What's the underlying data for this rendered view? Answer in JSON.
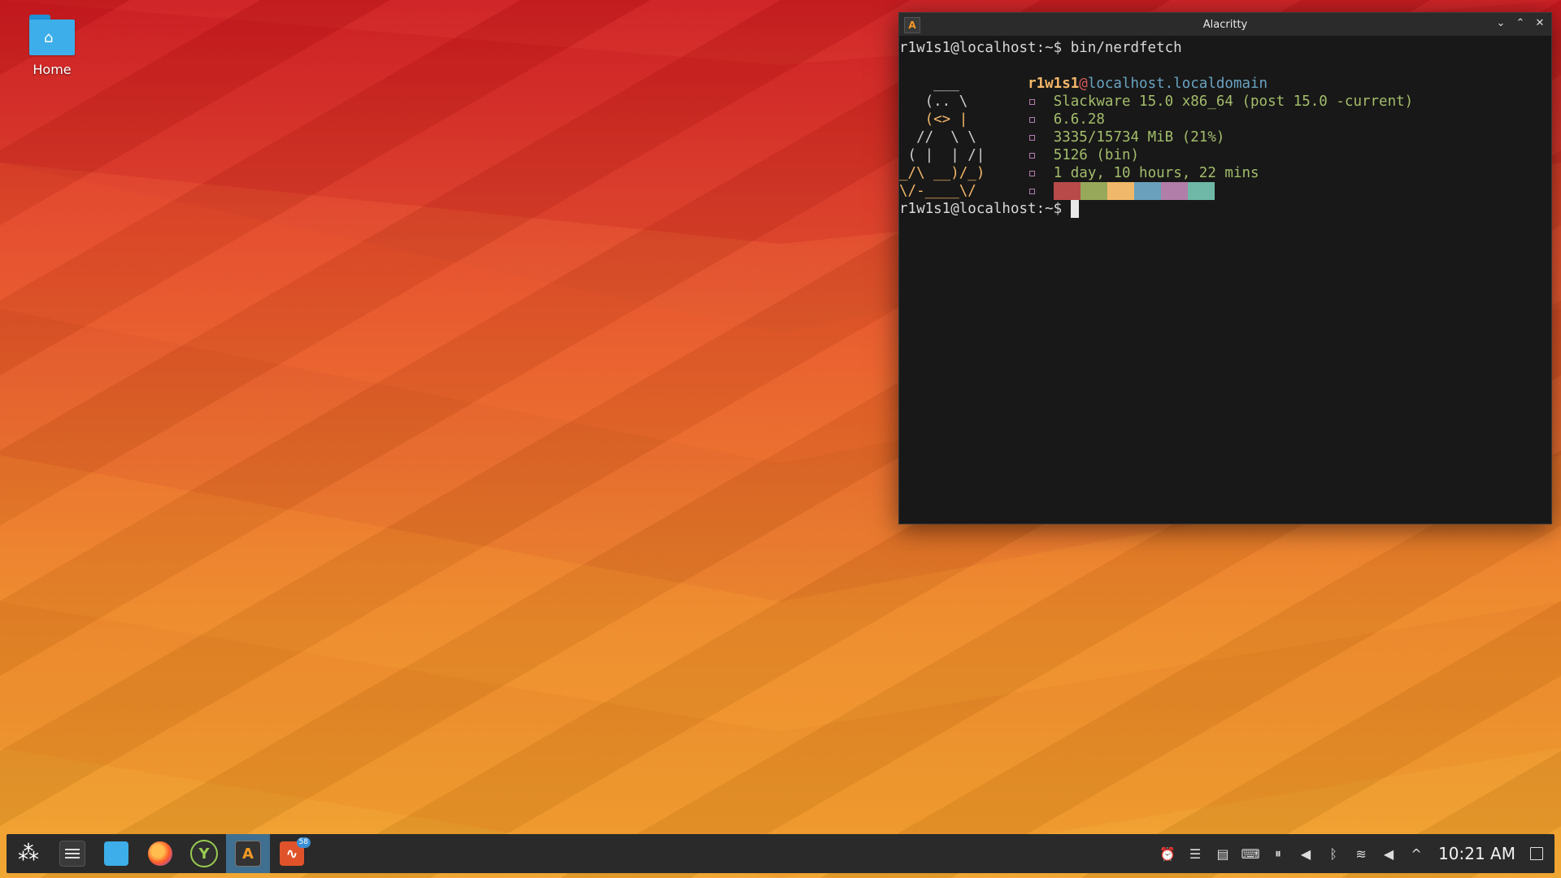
{
  "desktop": {
    "home_label": "Home"
  },
  "window": {
    "title": "Alacritty",
    "controls": {
      "minimize": "⌄",
      "maximize": "⌃",
      "close": "✕"
    },
    "app_icon_glyph": "A"
  },
  "terminal": {
    "prompt1": "r1w1s1@localhost:~$",
    "command1": " bin/nerdfetch",
    "ascii": [
      "    ___    ",
      "   (.. \\   ",
      "   (<> |   ",
      "  //  \\ \\  ",
      " ( |  | /| ",
      "_/\\ __)/_) ",
      "\\/-____\\/  "
    ],
    "user": "r1w1s1",
    "at": "@",
    "host": "localhost.localdomain",
    "bullet": "▫",
    "info": [
      "Slackware 15.0 x86_64 (post 15.0 -current)",
      "6.6.28",
      "3335/15734 MiB (21%)",
      "5126 (bin)",
      "1 day, 10 hours, 22 mins"
    ],
    "palette": [
      "#b84a4a",
      "#98a85a",
      "#f0b86a",
      "#6aa0bb",
      "#b07ea8",
      "#6fb8a8"
    ],
    "prompt2": "r1w1s1@localhost:~$"
  },
  "taskbar": {
    "rss_badge": "58",
    "clock": "10:21 AM",
    "tray_icons": [
      "alarm-icon",
      "rss-icon",
      "clipboard-icon",
      "keyboard-icon",
      "media-icon",
      "volume-icon",
      "bluetooth-icon",
      "wifi-icon",
      "speaker-icon",
      "expand-icon"
    ]
  }
}
